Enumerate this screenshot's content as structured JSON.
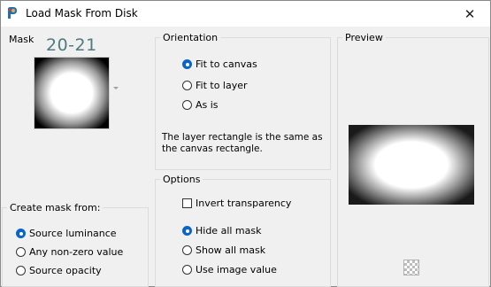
{
  "window": {
    "title": "Load Mask From Disk"
  },
  "mask": {
    "label": "Mask",
    "selected_name": "20-21"
  },
  "create_mask_from": {
    "label": "Create mask from:",
    "options": [
      "Source luminance",
      "Any non-zero value",
      "Source opacity"
    ],
    "selected": "Source luminance"
  },
  "orientation": {
    "label": "Orientation",
    "options": [
      "Fit to canvas",
      "Fit to layer",
      "As is"
    ],
    "selected": "Fit to canvas",
    "info": "The layer rectangle is the same as the canvas rectangle."
  },
  "options": {
    "label": "Options",
    "invert_transparency": {
      "label": "Invert transparency",
      "checked": false
    },
    "mask_display": [
      "Hide all mask",
      "Show all mask",
      "Use image value"
    ],
    "selected": "Hide all mask"
  },
  "preview": {
    "label": "Preview"
  },
  "icons": {
    "app": "paint-shop-icon",
    "close": "close-icon",
    "checker": "transparency-checker-icon"
  }
}
